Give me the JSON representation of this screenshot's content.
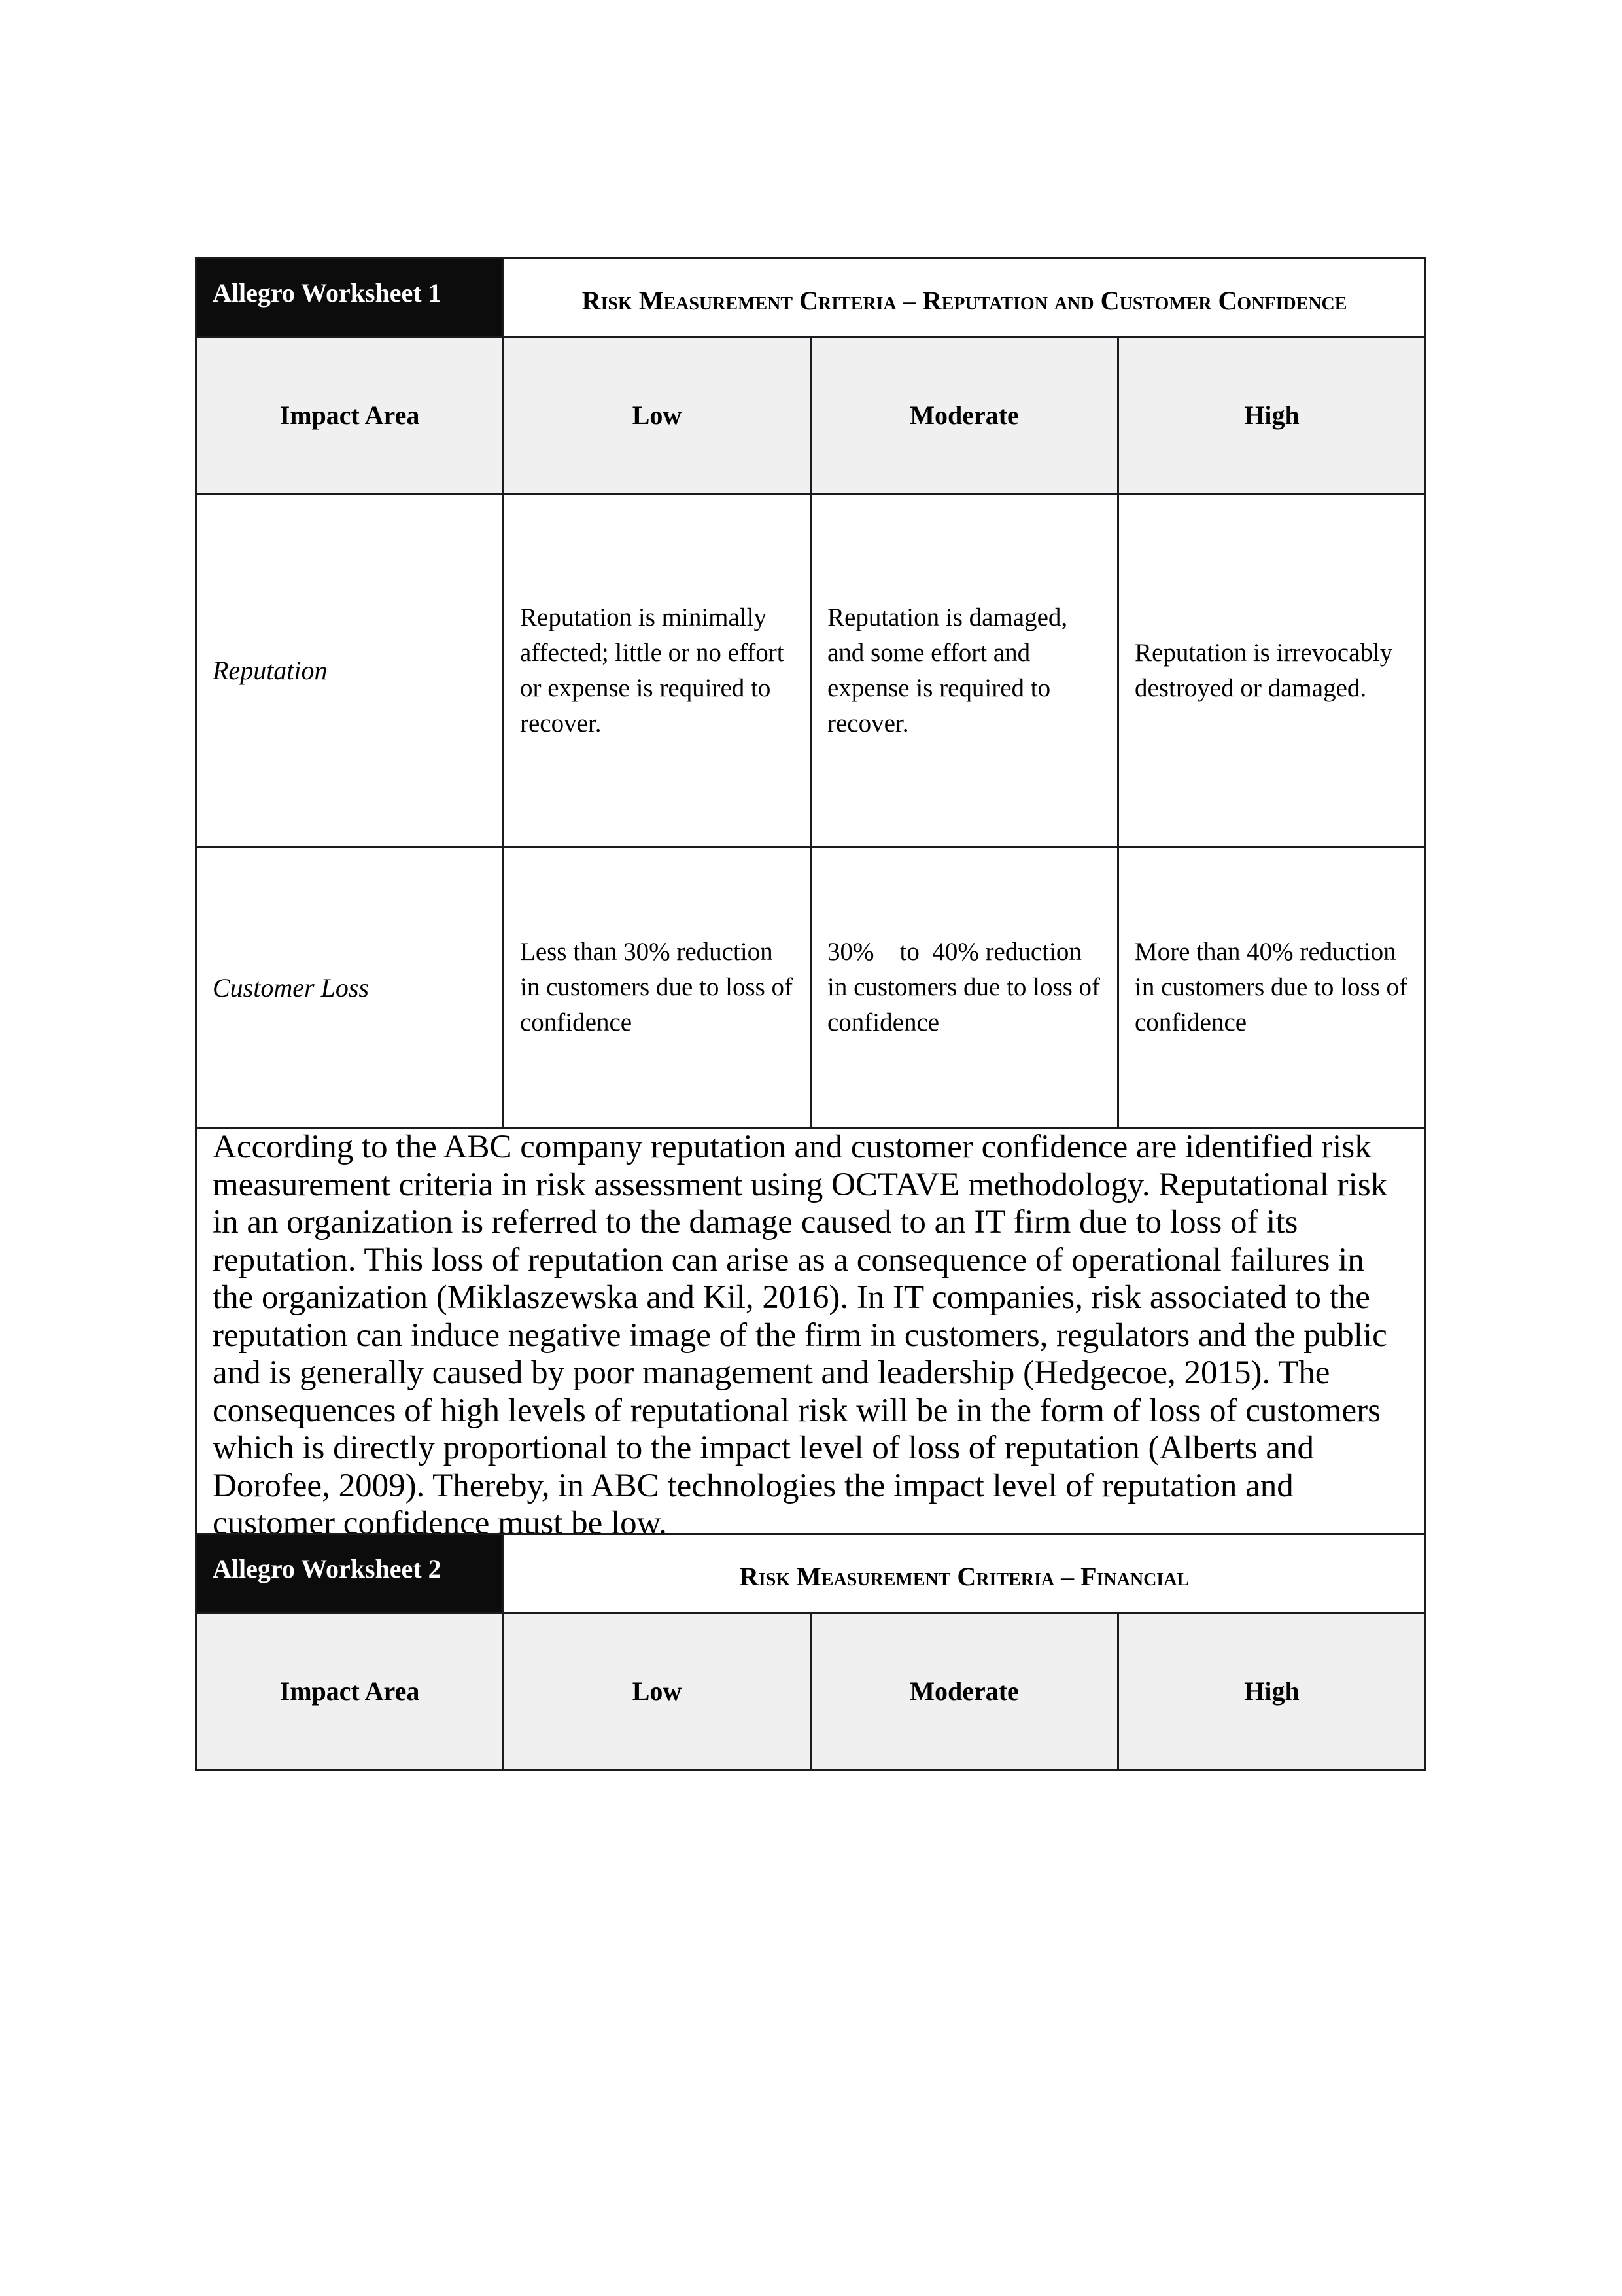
{
  "worksheets": [
    {
      "label": "Allegro Worksheet 1",
      "title": "Risk Measurement Criteria – Reputation and Customer Confidence",
      "columns": [
        "Impact Area",
        "Low",
        "Moderate",
        "High"
      ],
      "rows": [
        {
          "impact_area": "Reputation",
          "low": "Reputation is minimally affected; little or no effort or expense is required to recover.",
          "moderate": "Reputation is damaged, and some effort and expense is required to recover.",
          "high": "Reputation is irrevocably destroyed or damaged."
        },
        {
          "impact_area": "Customer Loss",
          "low": "Less than 30% reduction in customers due to loss of confidence",
          "moderate": "30%    to  40% reduction in customers due to loss of confidence",
          "high": "More than 40% reduction in customers due to loss of confidence"
        }
      ],
      "paragraph": "According to the ABC company reputation and customer confidence are identified risk measurement criteria in risk assessment using OCTAVE methodology. Reputational risk in an organization is referred to the damage caused to an IT firm due to loss of its reputation. This loss of reputation can arise as a consequence of operational failures in the organization (Miklaszewska and Kil, 2016). In IT companies, risk associated to the reputation can induce negative image of the firm in customers, regulators and the public and is generally caused by poor management and leadership (Hedgecoe, 2015). The consequences of high levels of reputational risk will be in the form of loss of customers which is directly proportional to the impact level of loss of reputation (Alberts and Dorofee, 2009). Thereby, in ABC technologies the impact level of reputation and customer confidence must be low."
    },
    {
      "label": "Allegro Worksheet 2",
      "title": "Risk Measurement Criteria – Financial",
      "columns": [
        "Impact Area",
        "Low",
        "Moderate",
        "High"
      ]
    }
  ],
  "colors": {
    "label_background": "#0c0c0c",
    "header_background": "#f0f0f0",
    "border": "#1a1a1f"
  }
}
